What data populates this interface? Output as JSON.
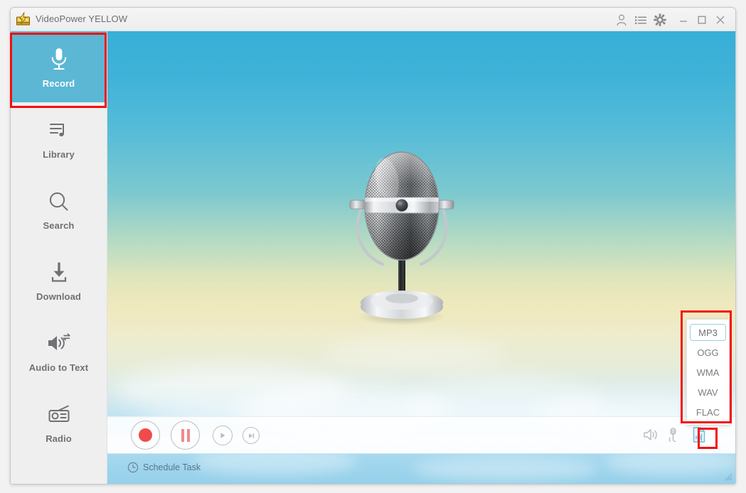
{
  "window": {
    "title": "VideoPower YELLOW",
    "logo_icon": "lightning-bolt-logo",
    "controls": [
      {
        "name": "account-icon",
        "label": "Account"
      },
      {
        "name": "list-icon",
        "label": "Task List"
      },
      {
        "name": "gear-icon",
        "label": "Settings"
      },
      {
        "name": "minimize-icon",
        "label": "Minimize"
      },
      {
        "name": "maximize-icon",
        "label": "Maximize"
      },
      {
        "name": "close-icon",
        "label": "Close"
      }
    ]
  },
  "sidebar": {
    "items": [
      {
        "label": "Record",
        "icon": "microphone-icon",
        "active": true
      },
      {
        "label": "Library",
        "icon": "music-list-icon",
        "active": false
      },
      {
        "label": "Search",
        "icon": "search-icon",
        "active": false
      },
      {
        "label": "Download",
        "icon": "download-icon",
        "active": false
      },
      {
        "label": "Audio to Text",
        "icon": "audio-to-text-icon",
        "active": false
      },
      {
        "label": "Radio",
        "icon": "radio-icon",
        "active": false
      }
    ]
  },
  "main": {
    "artwork": "vintage-studio-microphone"
  },
  "format_panel": {
    "selected": "MP3",
    "options": [
      "MP3",
      "OGG",
      "WMA",
      "WAV",
      "FLAC"
    ]
  },
  "transport": {
    "buttons": [
      {
        "name": "record-button",
        "label": "Record"
      },
      {
        "name": "pause-button",
        "label": "Pause"
      },
      {
        "name": "play-button",
        "label": "Play"
      },
      {
        "name": "next-button",
        "label": "Next"
      }
    ],
    "icons": [
      {
        "name": "speaker-icon",
        "label": "System Sound"
      },
      {
        "name": "microphone-in-icon",
        "label": "Microphone"
      },
      {
        "name": "audio-format-icon",
        "label": "Output Format"
      }
    ]
  },
  "schedule": {
    "label": "Schedule Task",
    "icon": "clock-icon"
  },
  "colors": {
    "accent": "#5cb7d5",
    "annotation": "#f50f0f",
    "record_dot": "#ef4b4b",
    "sidebar_bg": "#efefef",
    "schedule_bg": "#9ed5ed"
  }
}
